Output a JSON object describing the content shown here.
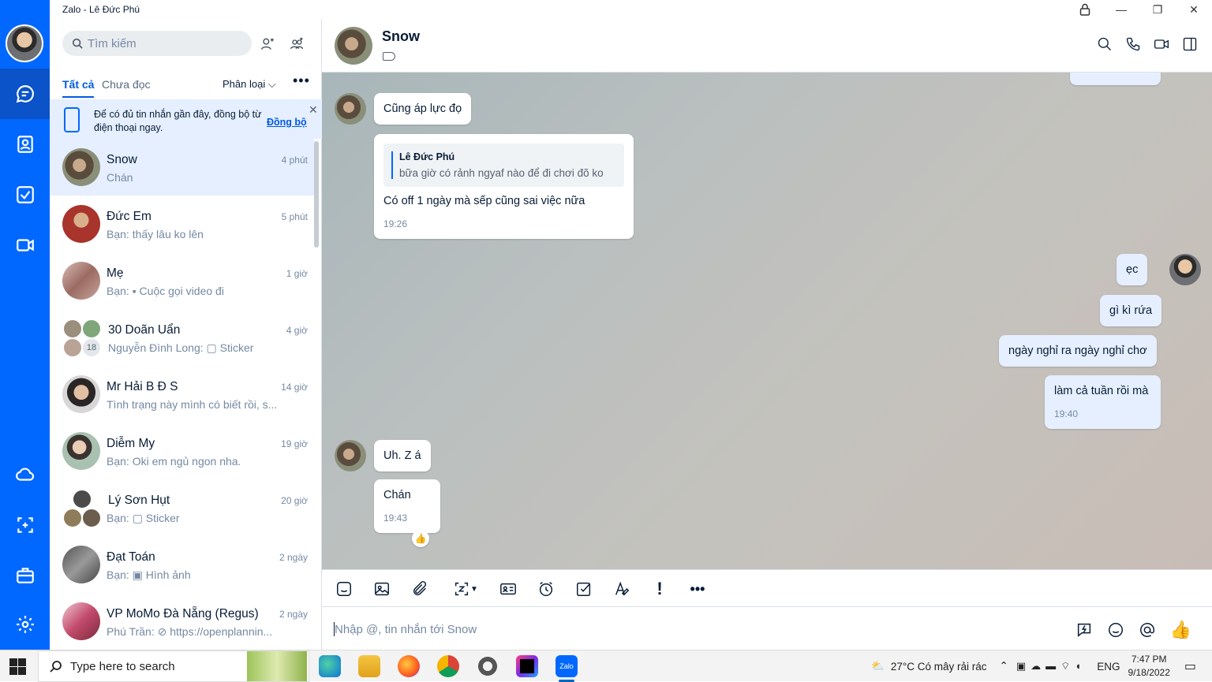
{
  "window": {
    "title": "Zalo - Lê Đức Phú"
  },
  "search": {
    "placeholder": "Tìm kiếm"
  },
  "tabs": {
    "all": "Tất cả",
    "unread": "Chưa đọc",
    "filter": "Phân loại",
    "more": "•••"
  },
  "sync": {
    "text": "Để có đủ tin nhắn gần đây, đồng bộ từ điện thoại ngay.",
    "link": "Đồng bộ",
    "close": "✕"
  },
  "conversations": [
    {
      "name": "Snow",
      "time": "4 phút",
      "preview": "Chán",
      "color": "#6b6a55"
    },
    {
      "name": "Đức Em",
      "time": "5 phút",
      "preview": "Bạn: thấy lâu ko lên",
      "color": "#a8342c"
    },
    {
      "name": "Mẹ",
      "time": "1 giờ",
      "preview": "Bạn: ▪ Cuộc gọi video đi",
      "color": "#b6908a"
    },
    {
      "name": "30 Doãn Uẩn",
      "time": "4 giờ",
      "preview": "Nguyễn Đình Long: ▢ Sticker",
      "badge": "18",
      "color": "#7f9a8a"
    },
    {
      "name": "Mr Hải B Đ S",
      "time": "14 giờ",
      "preview": "Tình trạng này mình có biết rồi, s...",
      "color": "#3d3a3a"
    },
    {
      "name": "Diễm My",
      "time": "19 giờ",
      "preview": "Bạn: Oki em ngủ ngon nha.",
      "color": "#9fb0a8"
    },
    {
      "name": "Lý Sơn Hụt",
      "time": "20 giờ",
      "preview": "Bạn: ▢ Sticker",
      "color": "#6f6a60"
    },
    {
      "name": "Đạt Toán",
      "time": "2 ngày",
      "preview": "Bạn: ▣ Hình ảnh",
      "color": "#777"
    },
    {
      "name": "VP MoMo Đà Nẵng (Regus)",
      "time": "2 ngày",
      "preview": "Phú Trần: ⊘ https://openplannin...",
      "color": "#c24a6b"
    }
  ],
  "chat": {
    "name": "Snow",
    "input_placeholder": "Nhập @, tin nhắn tới Snow",
    "messages": {
      "m1": "Cũng áp lực đọ",
      "quote_name": "Lê Đức Phú",
      "quote_text": "bữa giờ có rảnh ngyaf nào để đi chơi đõ ko",
      "m2": "Có off 1 ngày mà sếp cũng sai việc nữa",
      "m2_time": "19:26",
      "m3": "ẹc",
      "m4": "gì kì rứa",
      "m5": "ngày nghỉ ra ngày nghỉ chơ",
      "m6": "làm cả tuần rồi mà",
      "m6_time": "19:40",
      "m7": "Uh. Z á",
      "m8": "Chán",
      "m8_time": "19:43"
    }
  },
  "taskbar": {
    "search_placeholder": "Type here to search",
    "weather": "27°C  Có mây rải rác",
    "lang": "ENG",
    "time": "7:47 PM",
    "date": "9/18/2022"
  }
}
